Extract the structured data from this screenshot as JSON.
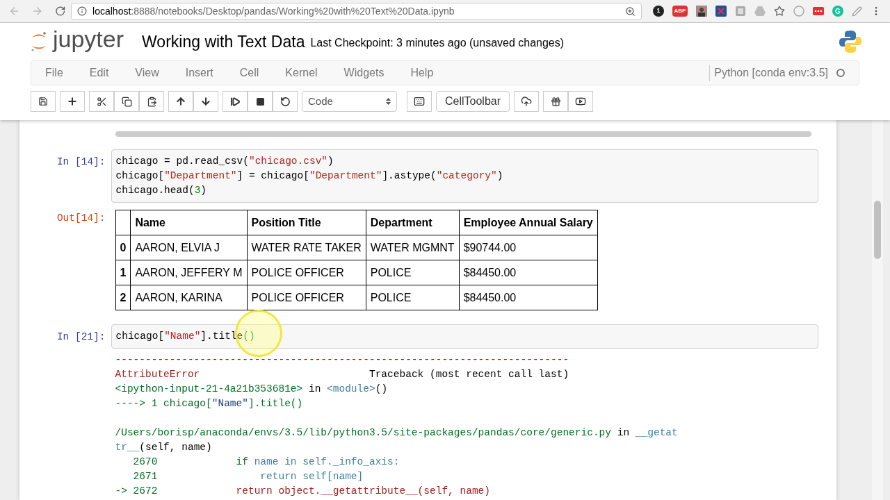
{
  "browser": {
    "url_host": "localhost",
    "url_rest": ":8888/notebooks/Desktop/pandas/Working%20with%20Text%20Data.ipynb",
    "extensions": [
      {
        "kind": "badge",
        "label": "1"
      },
      {
        "kind": "abp",
        "label": "ABP"
      },
      {
        "kind": "avatar"
      },
      {
        "kind": "tile"
      },
      {
        "kind": "square"
      },
      {
        "kind": "drive"
      },
      {
        "kind": "star"
      },
      {
        "kind": "wifi"
      },
      {
        "kind": "dots"
      },
      {
        "kind": "grammarly",
        "label": "G"
      },
      {
        "kind": "pen"
      }
    ]
  },
  "header": {
    "logo_text": "jupyter",
    "notebook_title": "Working with Text Data",
    "checkpoint": "Last Checkpoint: 3 minutes ago (unsaved changes)"
  },
  "menu": {
    "items": [
      "File",
      "Edit",
      "View",
      "Insert",
      "Cell",
      "Kernel",
      "Widgets",
      "Help"
    ],
    "kernel": "Python [conda env:3.5]"
  },
  "toolbar": {
    "cell_type": "Code",
    "celltoolbar": "CellToolbar"
  },
  "cells": [
    {
      "kind": "input",
      "prompt": "In [14]:",
      "lines": [
        [
          {
            "text": "chicago = pd.read_csv(",
            "kind": "plain"
          },
          {
            "text": "\"chicago.csv\"",
            "kind": "string"
          },
          {
            "text": ")",
            "kind": "plain"
          }
        ],
        [
          {
            "text": "chicago[",
            "kind": "plain"
          },
          {
            "text": "\"Department\"",
            "kind": "string"
          },
          {
            "text": "] = chicago[",
            "kind": "plain"
          },
          {
            "text": "\"Department\"",
            "kind": "string"
          },
          {
            "text": "].astype(",
            "kind": "plain"
          },
          {
            "text": "\"category\"",
            "kind": "string"
          },
          {
            "text": ")",
            "kind": "plain"
          }
        ],
        [
          {
            "text": "chicago.head(",
            "kind": "plain"
          },
          {
            "text": "3",
            "kind": "number"
          },
          {
            "text": ")",
            "kind": "plain"
          }
        ]
      ]
    },
    {
      "kind": "table",
      "prompt": "Out[14]:",
      "columns": [
        "",
        "Name",
        "Position Title",
        "Department",
        "Employee Annual Salary"
      ],
      "rows": [
        [
          "0",
          "AARON, ELVIA J",
          "WATER RATE TAKER",
          "WATER MGMNT",
          "$90744.00"
        ],
        [
          "1",
          "AARON, JEFFERY M",
          "POLICE OFFICER",
          "POLICE",
          "$84450.00"
        ],
        [
          "2",
          "AARON, KARINA",
          "POLICE OFFICER",
          "POLICE",
          "$84450.00"
        ]
      ]
    },
    {
      "kind": "input",
      "prompt": "In [21]:",
      "lines": [
        [
          {
            "text": "chicago[",
            "kind": "plain"
          },
          {
            "text": "\"Name\"",
            "kind": "string"
          },
          {
            "text": "].title",
            "kind": "plain"
          },
          {
            "text": "()",
            "kind": "bracket"
          }
        ]
      ]
    },
    {
      "kind": "traceback",
      "lines": [
        [
          {
            "text": "---------------------------------------------------------------------------",
            "kind": "red"
          }
        ],
        [
          {
            "text": "AttributeError",
            "kind": "darkred"
          },
          {
            "text": "                            Traceback (most recent call last)",
            "kind": "plain"
          }
        ],
        [
          {
            "text": "<ipython-input-21-4a21b353681e>",
            "kind": "green"
          },
          {
            "text": " in ",
            "kind": "plain"
          },
          {
            "text": "<module>",
            "kind": "cyan"
          },
          {
            "text": "()",
            "kind": "plain"
          }
        ],
        [
          {
            "text": "----> 1 chicago[",
            "kind": "green"
          },
          {
            "text": "\"Name\"",
            "kind": "blue"
          },
          {
            "text": "].title()",
            "kind": "green"
          }
        ]
      ]
    },
    {
      "kind": "traceback",
      "lines": [
        [
          {
            "text": "/Users/borisp/anaconda/envs/3.5/lib/python3.5/site-packages/pandas/core/generic.py",
            "kind": "green"
          },
          {
            "text": " in ",
            "kind": "plain"
          },
          {
            "text": "__getat",
            "kind": "cyan"
          }
        ],
        [
          {
            "text": "tr__",
            "kind": "cyan"
          },
          {
            "text": "(self, name)",
            "kind": "plain"
          }
        ],
        [
          {
            "text": "   2670             if",
            "kind": "green"
          },
          {
            "text": " name in self._info_axis:",
            "kind": "cyan"
          }
        ],
        [
          {
            "text": "   2671",
            "kind": "green"
          },
          {
            "text": "                 return self[name]",
            "kind": "cyan"
          }
        ],
        [
          {
            "text": "-> 2672",
            "kind": "green"
          },
          {
            "text": "             return object.__getattribute__(self, name)",
            "kind": "darkred"
          }
        ]
      ]
    }
  ]
}
